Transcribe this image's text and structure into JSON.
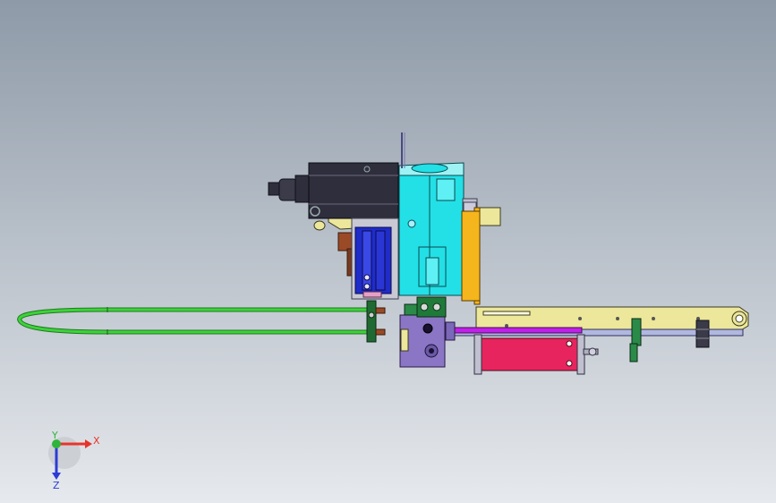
{
  "viewport": {
    "background_top": "#8e9aa8",
    "background_bottom": "#e6e9ed"
  },
  "triad": {
    "x_label": "X",
    "y_label": "Y",
    "z_label": "Z",
    "x_color": "#e8332a",
    "y_color": "#2fb43a",
    "z_color": "#2c3bd6"
  },
  "parts": {
    "cyan_block": "#22e0e6",
    "orange_plate": "#f5b51c",
    "yellow_rail": "#ece79a",
    "blue_slide": "#1f2cc8",
    "brown_bracket": "#9a4a26",
    "dark_cylinder": "#2e2e3c",
    "purple_block": "#8a76c4",
    "magenta_cylinder": "#e8245e",
    "violet_rod": "#c020e8",
    "green_hose": "#3ed23a",
    "green_clamp": "#1f7a3a",
    "gray_frame": "#c0c0d0"
  }
}
